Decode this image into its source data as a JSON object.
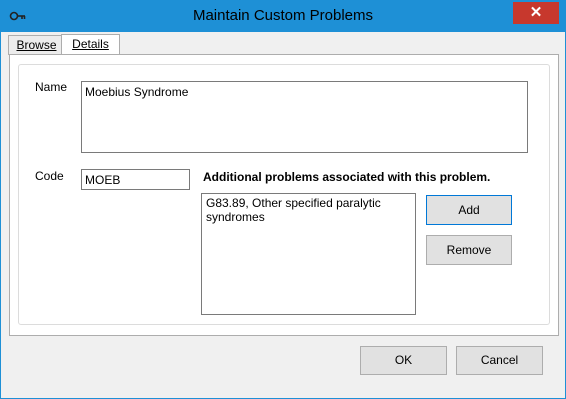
{
  "window": {
    "title": "Maintain Custom Problems",
    "close_glyph": "✕"
  },
  "tabs": [
    {
      "label": "Browse",
      "selected": false
    },
    {
      "label": "Details",
      "selected": true
    }
  ],
  "form": {
    "name_label": "Name",
    "name_value": "Moebius Syndrome",
    "code_label": "Code",
    "code_value": "MOEB",
    "additional_label": "Additional problems associated with this problem.",
    "additional_items": [
      "G83.89, Other specified paralytic syndromes"
    ],
    "add_label": "Add",
    "remove_label": "Remove"
  },
  "footer": {
    "ok_label": "OK",
    "cancel_label": "Cancel"
  },
  "colors": {
    "titlebar": "#1e90d6",
    "close": "#c7382d",
    "focus_border": "#0078d7"
  },
  "icons": {
    "app": "key-icon",
    "close": "close-icon"
  }
}
